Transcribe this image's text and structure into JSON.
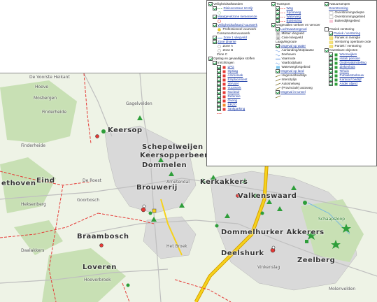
{
  "map": {
    "places": [
      {
        "name": "Keersop",
        "cls": "big"
      },
      {
        "name": "Schepelweijen",
        "cls": "big"
      },
      {
        "name": "Keersopperbeemden",
        "cls": "big"
      },
      {
        "name": "Dommelen",
        "cls": "big"
      },
      {
        "name": "Brouwerij",
        "cls": "big"
      },
      {
        "name": "Valkenswaard",
        "cls": "big"
      },
      {
        "name": "Braambosch",
        "cls": "big"
      },
      {
        "name": "Loveren",
        "cls": "big"
      },
      {
        "name": "Dommelhurker Akkerers",
        "cls": "big"
      },
      {
        "name": "Zeelberg",
        "cls": "big"
      },
      {
        "name": "Kerkakkers",
        "cls": "big"
      },
      {
        "name": "Eind",
        "cls": "big"
      },
      {
        "name": "Deelshurk",
        "cls": "big"
      },
      {
        "name": "ethoven",
        "cls": "big"
      },
      {
        "name": "De Voorste Heikant",
        "cls": "small"
      },
      {
        "name": "Hoeve",
        "cls": "small"
      },
      {
        "name": "Mosbergen",
        "cls": "small"
      },
      {
        "name": "Finderheide",
        "cls": "small"
      },
      {
        "name": "Finderheide",
        "cls": "small"
      },
      {
        "name": "Gagelvelden",
        "cls": "small"
      },
      {
        "name": "Arnetendal",
        "cls": "small"
      },
      {
        "name": "De Roest",
        "cls": "small"
      },
      {
        "name": "Goorbosch",
        "cls": "small"
      },
      {
        "name": "Heksenberg",
        "cls": "small"
      },
      {
        "name": "Daalakkers",
        "cls": "small"
      },
      {
        "name": "Het Broek",
        "cls": "small"
      },
      {
        "name": "Hoeverbroek",
        "cls": "small"
      },
      {
        "name": "Vinkenslag",
        "cls": "small"
      },
      {
        "name": "Molenvelden",
        "cls": "small"
      },
      {
        "name": "Schaapsloop",
        "cls": "small"
      }
    ]
  },
  "legend": {
    "col1": [
      {
        "label": "Veiligheidsafstanden",
        "type": "head",
        "check": "on"
      },
      {
        "label": "Risicocontour 10-6/jr",
        "type": "link",
        "check": "on",
        "indent": 1,
        "sym": "dash-green"
      },
      {
        "label": "",
        "type": "sym",
        "indent": 2,
        "sym": "circle-dash"
      },
      {
        "label": "Maatgevelzone riemenenze",
        "type": "link",
        "check": "on",
        "indent": 1,
        "sym": "none"
      },
      {
        "label": "",
        "type": "sym",
        "indent": 2,
        "sym": "circle-red"
      },
      {
        "label": "Veiligheidsafstand vuurwerk",
        "type": "link",
        "check": "on",
        "indent": 1,
        "sym": "none"
      },
      {
        "label": "Professioneel vuurwerk",
        "type": "text",
        "indent": 2,
        "sym": "circle-yellow"
      },
      {
        "label": "Consumentenvuurwerk",
        "type": "text",
        "indent": 2,
        "sym": "none"
      },
      {
        "label": "Zone 1 vliegveld",
        "type": "link",
        "check": "on",
        "indent": 1,
        "sym": "line-blue"
      },
      {
        "label": "Zone diverse",
        "type": "link",
        "check": "on",
        "indent": 1,
        "sym": "none"
      },
      {
        "label": "Zone A",
        "type": "text",
        "indent": 2,
        "sym": "circle-outline"
      },
      {
        "label": "Zone B",
        "type": "text",
        "indent": 2,
        "sym": "circle-outline"
      },
      {
        "label": "Zone C",
        "type": "text",
        "indent": 2,
        "sym": "none"
      },
      {
        "label": "Opslag en gevaarlijke stoffen",
        "type": "head",
        "check": "on"
      },
      {
        "label": "Inrichtingen",
        "type": "head",
        "check": "on",
        "indent": 1
      },
      {
        "label": "LPG",
        "type": "link",
        "check": "on",
        "indent": 2,
        "sym": "sq-red"
      },
      {
        "label": "Opslag",
        "type": "link",
        "check": "on",
        "indent": 2,
        "sym": "sq-red"
      },
      {
        "label": "Ammoniak",
        "type": "link",
        "check": "on",
        "indent": 2,
        "sym": "sq-red"
      },
      {
        "label": "Emplacement",
        "type": "link",
        "check": "on",
        "indent": 2,
        "sym": "sq-red"
      },
      {
        "label": "Vervoer",
        "type": "link",
        "check": "on",
        "indent": 2,
        "sym": "sq-red"
      },
      {
        "label": "Vuurwerk",
        "type": "link",
        "check": "on",
        "indent": 2,
        "sym": "sq-red"
      },
      {
        "label": "Nucleair",
        "type": "link",
        "check": "on",
        "indent": 2,
        "sym": "sq-red"
      },
      {
        "label": "Defensie",
        "type": "link",
        "check": "on",
        "indent": 2,
        "sym": "sq-red"
      },
      {
        "label": "Overig",
        "type": "link",
        "check": "on",
        "indent": 2,
        "sym": "sq-red"
      },
      {
        "label": "BRZO",
        "type": "link",
        "check": "on",
        "indent": 2,
        "sym": "sq-orange"
      },
      {
        "label": "Tankparking",
        "type": "link",
        "check": "on",
        "indent": 2,
        "sym": "sq-red"
      },
      {
        "label": "",
        "type": "sym",
        "indent": 2,
        "sym": "dash-red"
      }
    ],
    "col2": [
      {
        "label": "Transport",
        "type": "head",
        "check": "on"
      },
      {
        "label": "Weg",
        "type": "link",
        "check": "on",
        "indent": 1,
        "sym": "dash-red"
      },
      {
        "label": "Spoorweg",
        "type": "link",
        "check": "on",
        "indent": 1,
        "sym": "dash-red"
      },
      {
        "label": "Waterweg",
        "type": "link",
        "check": "on",
        "indent": 1,
        "sym": "dash-red"
      },
      {
        "label": "Buisleiding",
        "type": "link",
        "check": "on",
        "indent": 1,
        "sym": "dash-red"
      },
      {
        "label": "Ongevallen verkeer en vervoer",
        "type": "head",
        "check": "on"
      },
      {
        "label": "Luchtvaartongeval",
        "type": "link",
        "check": "on",
        "indent": 1,
        "sym": "none"
      },
      {
        "label": "Militair vliegveld",
        "type": "text",
        "indent": 1,
        "sym": "plane-gray"
      },
      {
        "label": "Civiel vliegveld",
        "type": "text",
        "indent": 1,
        "sym": "plane-gray"
      },
      {
        "label": "Laagvliegroute",
        "type": "text",
        "indent": 1,
        "sym": "none"
      },
      {
        "label": "Ongeval op water",
        "type": "link",
        "check": "on",
        "indent": 1,
        "sym": "none"
      },
      {
        "label": "Aanlanding/stotplaatse",
        "type": "text",
        "indent": 1,
        "sym": "wave"
      },
      {
        "label": "Zeehaven",
        "type": "text",
        "indent": 1,
        "sym": "wave"
      },
      {
        "label": "Vaarroute",
        "type": "text",
        "indent": 1,
        "sym": "line-blue"
      },
      {
        "label": "Vaarbodplaats",
        "type": "text",
        "indent": 1,
        "sym": "wave"
      },
      {
        "label": "Waterwegfortgebied",
        "type": "text",
        "indent": 1,
        "sym": "sq-blue"
      },
      {
        "label": "Ongeval op land",
        "type": "link",
        "check": "on",
        "indent": 1,
        "sym": "none"
      },
      {
        "label": "Hogesnelheidslijn",
        "type": "text",
        "indent": 1,
        "sym": "rail"
      },
      {
        "label": "Intercitylijn",
        "type": "text",
        "indent": 1,
        "sym": "rail"
      },
      {
        "label": "Autosnelweg",
        "type": "text",
        "indent": 1,
        "sym": "rail"
      },
      {
        "label": "(Provinciale) autoweg",
        "type": "text",
        "indent": 1,
        "sym": "rail"
      },
      {
        "label": "Ongeval in tunnel",
        "type": "link",
        "check": "on",
        "indent": 1,
        "sym": "none"
      },
      {
        "label": "",
        "type": "sym",
        "indent": 1,
        "sym": "rail"
      }
    ],
    "col3": [
      {
        "label": "Natuurrampen",
        "type": "head",
        "check": "on"
      },
      {
        "label": "Overstroming",
        "type": "link",
        "indent": 1,
        "sym": "none"
      },
      {
        "label": "Overstromingsdiepte",
        "type": "text",
        "indent": 1,
        "sym": "sq-outline"
      },
      {
        "label": "Overstromingsgebied",
        "type": "text",
        "indent": 1,
        "sym": "sq-outline"
      },
      {
        "label": "Buitendijksgebied",
        "type": "text",
        "indent": 1,
        "sym": "sq-pink"
      },
      {
        "label": "",
        "type": "sym",
        "indent": 1,
        "sym": "none"
      },
      {
        "label": "Paniek verstoring",
        "type": "head",
        "check": "off"
      },
      {
        "label": "Paniek / verstoring",
        "type": "link",
        "check": "on",
        "indent": 1,
        "sym": "none"
      },
      {
        "label": "Paniek in menigte",
        "type": "text",
        "indent": 1,
        "sym": "sq-yellow"
      },
      {
        "label": "Verstoring openbare orde",
        "type": "text",
        "indent": 1,
        "sym": "sq-yellow"
      },
      {
        "label": "Paniek / verstoring",
        "type": "text",
        "indent": 1,
        "sym": "sq-yellow"
      },
      {
        "label": "Kwetsbare objecten",
        "type": "head",
        "check": "on"
      },
      {
        "label": "Woonwijken",
        "type": "link",
        "check": "on",
        "indent": 1,
        "sym": "sq-green"
      },
      {
        "label": "Hotel/ pension",
        "type": "link",
        "check": "on",
        "indent": 1,
        "sym": "sq-green"
      },
      {
        "label": "Onderwijsinstelling",
        "type": "link",
        "check": "on",
        "indent": 1,
        "sym": "sq-green"
      },
      {
        "label": "Ziekenhuis",
        "type": "link",
        "check": "on",
        "indent": 1,
        "sym": "sq-green"
      },
      {
        "label": "Tehuis",
        "type": "link",
        "check": "on",
        "indent": 1,
        "sym": "sq-green"
      },
      {
        "label": "Publiekstoebouw",
        "type": "link",
        "check": "on",
        "indent": 1,
        "sym": "sq-green"
      },
      {
        "label": "Kantoor/ bedrijf",
        "type": "link",
        "check": "on",
        "indent": 1,
        "sym": "sq-green"
      },
      {
        "label": "Ander object",
        "type": "link",
        "check": "on",
        "indent": 1,
        "sym": "sq-green"
      }
    ]
  }
}
